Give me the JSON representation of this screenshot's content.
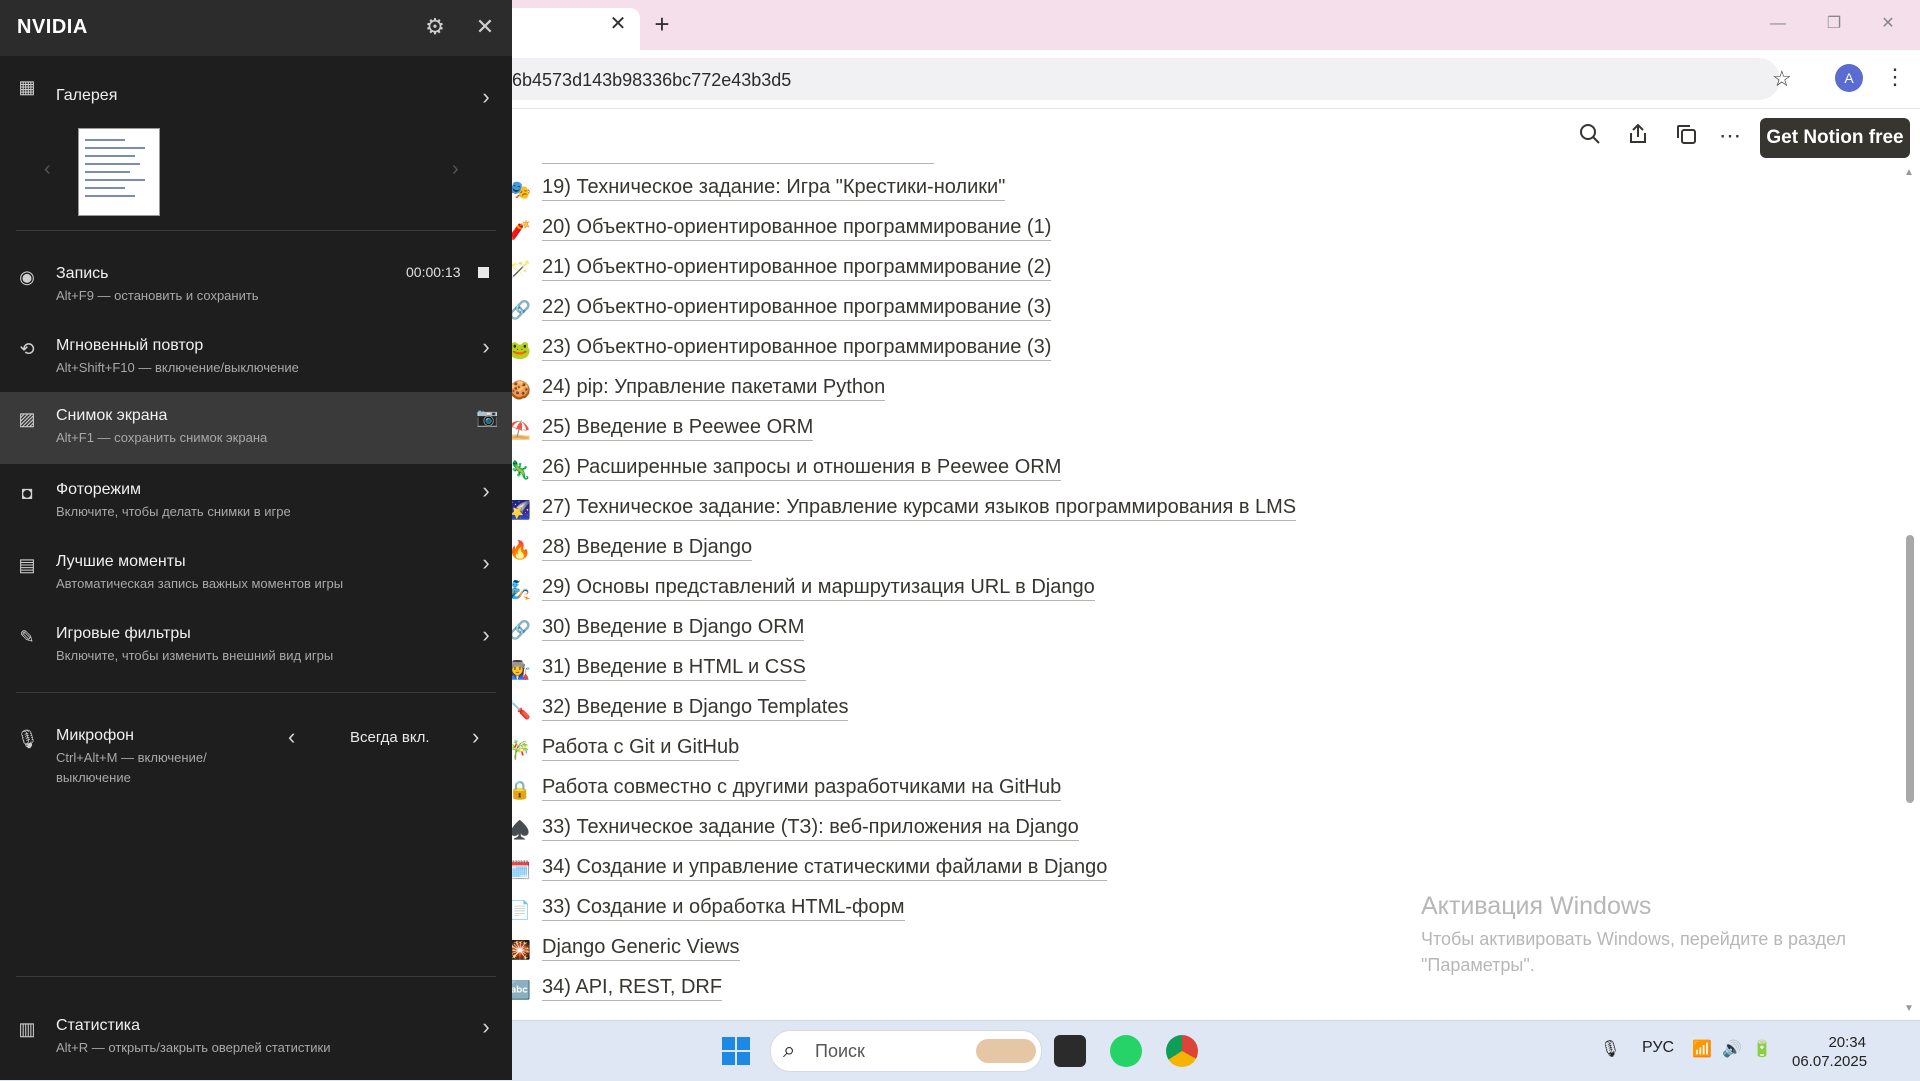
{
  "browser": {
    "url": "6b4573d143b98336bc772e43b3d5",
    "tab_close": "✕",
    "new_tab": "+",
    "avatar_letter": "A"
  },
  "notion": {
    "get_free": "Get Notion free",
    "items": [
      {
        "emoji": "🎭",
        "text": "19) Техническое задание: Игра \"Крестики-нолики\""
      },
      {
        "emoji": "🧨",
        "text": "20) Объектно-ориентированное программирование (1)"
      },
      {
        "emoji": "🪄",
        "text": "21) Объектно-ориентированное программирование (2)"
      },
      {
        "emoji": "🔗",
        "text": "22) Объектно-ориентированное программирование (3)"
      },
      {
        "emoji": "🐸",
        "text": "23) Объектно-ориентированное программирование (3)"
      },
      {
        "emoji": "🍪",
        "text": "24) pip: Управление пакетами Python"
      },
      {
        "emoji": "⛱️",
        "text": "25) Введение в Peewee ORM"
      },
      {
        "emoji": "🦎",
        "text": "26) Расширенные запросы и отношения в Peewee ORM"
      },
      {
        "emoji": "🌠",
        "text": "27) Техническое задание: Управление курсами языков программирования в LMS"
      },
      {
        "emoji": "🔥",
        "text": "28) Введение в Django"
      },
      {
        "emoji": "🧞",
        "text": "29) Основы представлений и маршрутизация URL в Django"
      },
      {
        "emoji": "🔗",
        "text": "30) Введение в Django ORM"
      },
      {
        "emoji": "👩‍🏭",
        "text": "31) Введение в HTML и CSS"
      },
      {
        "emoji": "🪛",
        "text": "32) Введение в Django Templates"
      },
      {
        "emoji": "🎋",
        "text": "Работа с Git и GitHub"
      },
      {
        "emoji": "🔒",
        "text": "Работа совместно с другими разработчиками на GitHub"
      },
      {
        "emoji": "♠️",
        "text": "33) Техническое задание (ТЗ): веб-приложения на Django"
      },
      {
        "emoji": "🗓️",
        "text": "34) Создание и управление статическими файлами в Django"
      },
      {
        "emoji": "📄",
        "text": "33) Создание и обработка HTML-форм"
      },
      {
        "emoji": "🎇",
        "text": "Django Generic Views"
      },
      {
        "emoji": "🔤",
        "text": "34) API, REST, DRF"
      }
    ]
  },
  "watermark": {
    "title": "Активация Windows",
    "text": "Чтобы активировать Windows, перейдите в раздел \"Параметры\"."
  },
  "taskbar": {
    "search_placeholder": "Поиск",
    "lang": "РУС",
    "time": "20:34",
    "date": "06.07.2025"
  },
  "nvidia": {
    "title": "NVIDIA",
    "gallery": {
      "label": "Галерея"
    },
    "record": {
      "label": "Запись",
      "sub": "Alt+F9 — остановить и сохранить",
      "time": "00:00:13"
    },
    "instant_replay": {
      "label": "Мгновенный повтор",
      "sub": "Alt+Shift+F10 — включение/выключение"
    },
    "screenshot": {
      "label": "Снимок экрана",
      "sub": "Alt+F1 — сохранить снимок экрана"
    },
    "photo_mode": {
      "label": "Фоторежим",
      "sub": "Включите, чтобы делать снимки в игре"
    },
    "highlights": {
      "label": "Лучшие моменты",
      "sub": "Автоматическая запись важных моментов игры"
    },
    "filters": {
      "label": "Игровые фильтры",
      "sub": "Включите, чтобы изменить внешний вид игры"
    },
    "microphone": {
      "label": "Микрофон",
      "sub1": "Ctrl+Alt+M — включение/",
      "sub2": "выключение",
      "value": "Всегда вкл."
    },
    "stats": {
      "label": "Статистика",
      "sub": "Alt+R — открыть/закрыть оверлей статистики"
    }
  },
  "colors": {
    "accent_dark": "#37352f",
    "nvidia_panel": "#1e1e1e",
    "windows_blue": "#1e88e5"
  }
}
